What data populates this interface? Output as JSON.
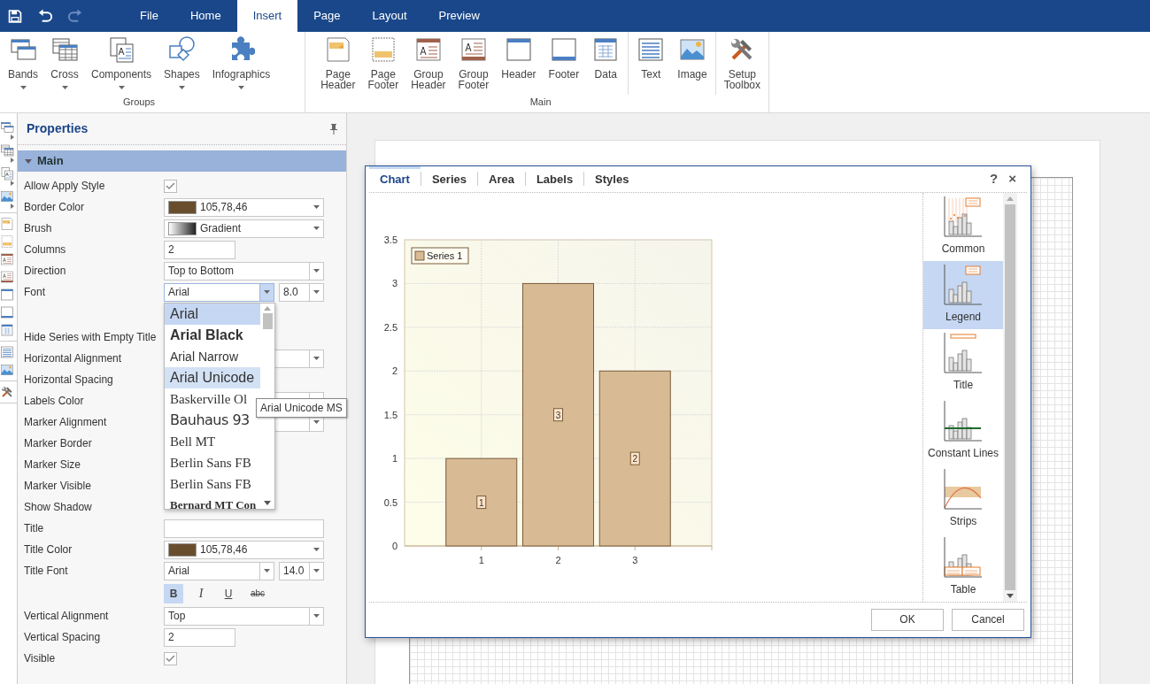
{
  "quick_access": [
    {
      "kind": "save",
      "disabled": false
    },
    {
      "kind": "undo",
      "disabled": false
    },
    {
      "kind": "redo",
      "disabled": true
    }
  ],
  "tabs": [
    {
      "label": "File",
      "selected": false
    },
    {
      "label": "Home",
      "selected": false
    },
    {
      "label": "Insert",
      "selected": true
    },
    {
      "label": "Page",
      "selected": false
    },
    {
      "label": "Layout",
      "selected": false
    },
    {
      "label": "Preview",
      "selected": false
    }
  ],
  "ribbon": {
    "groups": [
      {
        "label": "Groups",
        "sections": [
          [
            {
              "label": "Bands",
              "kind": "bands",
              "dropdown": true
            },
            {
              "label": "Cross",
              "kind": "cross",
              "dropdown": true
            },
            {
              "label": "Components",
              "kind": "components",
              "dropdown": true
            },
            {
              "label": "Shapes",
              "kind": "shapes",
              "dropdown": true
            },
            {
              "label": "Infographics",
              "kind": "infographics",
              "dropdown": true
            }
          ]
        ]
      },
      {
        "label": "Main",
        "sections": [
          [
            {
              "label": "Page Header",
              "kind": "page-header",
              "dropdown": false
            },
            {
              "label": "Page Footer",
              "kind": "page-footer",
              "dropdown": false
            },
            {
              "label": "Group Header",
              "kind": "group-header",
              "dropdown": false
            },
            {
              "label": "Group Footer",
              "kind": "group-footer",
              "dropdown": false
            },
            {
              "label": "Header",
              "kind": "header",
              "dropdown": false
            },
            {
              "label": "Footer",
              "kind": "footer",
              "dropdown": false
            },
            {
              "label": "Data",
              "kind": "data",
              "dropdown": false
            }
          ],
          [
            {
              "label": "Text",
              "kind": "text",
              "dropdown": false
            },
            {
              "label": "Image",
              "kind": "image",
              "dropdown": false
            }
          ],
          [
            {
              "label": "Setup Toolbox",
              "kind": "toolbox",
              "dropdown": false
            }
          ]
        ]
      }
    ]
  },
  "toolbox": [
    [
      {
        "kind": "bands",
        "expandable": true
      },
      {
        "kind": "cross",
        "expandable": true
      },
      {
        "kind": "components",
        "expandable": true
      },
      {
        "kind": "image",
        "expandable": true
      }
    ],
    [
      {
        "kind": "page-header",
        "expandable": false
      },
      {
        "kind": "page-footer",
        "expandable": false
      },
      {
        "kind": "group-header",
        "expandable": false
      },
      {
        "kind": "group-footer",
        "expandable": false
      },
      {
        "kind": "header",
        "expandable": false
      },
      {
        "kind": "footer",
        "expandable": false
      },
      {
        "kind": "data",
        "expandable": false
      }
    ],
    [
      {
        "kind": "text",
        "expandable": false
      },
      {
        "kind": "image",
        "expandable": false
      }
    ],
    [
      {
        "kind": "toolbox",
        "expandable": false
      }
    ]
  ],
  "properties": {
    "title": "Properties",
    "section": {
      "label": "Main",
      "expanded": true
    },
    "rows": [
      {
        "label": "Allow Apply Style",
        "editor": {
          "kind": "checkbox",
          "checked": true
        }
      },
      {
        "label": "Border Color",
        "editor": {
          "kind": "color",
          "color": "#694e2e",
          "value": "105,78,46"
        }
      },
      {
        "label": "Brush",
        "editor": {
          "kind": "brush",
          "value": "Gradient"
        }
      },
      {
        "label": "Columns",
        "editor": {
          "kind": "number",
          "value": "2"
        }
      },
      {
        "label": "Direction",
        "editor": {
          "kind": "select",
          "value": "Top to Bottom"
        }
      },
      {
        "label": "Font",
        "editor": {
          "kind": "font",
          "value": "Arial",
          "size": "8.0",
          "open": true,
          "tooltip": "Arial Unicode MS",
          "options": [
            {
              "label": "Arial",
              "kind": "regular",
              "selected": true,
              "hovered": false
            },
            {
              "label": "Arial Black",
              "kind": "black",
              "selected": false,
              "hovered": false
            },
            {
              "label": "Arial Narrow",
              "kind": "narrow",
              "selected": false,
              "hovered": false
            },
            {
              "label": "Arial Unicode",
              "kind": "regular",
              "selected": false,
              "hovered": true
            },
            {
              "label": "Baskerville Ol",
              "kind": "serif",
              "selected": false,
              "hovered": false
            },
            {
              "label": "Bauhaus 93",
              "kind": "display",
              "selected": false,
              "hovered": false
            },
            {
              "label": "Bell MT",
              "kind": "serif",
              "selected": false,
              "hovered": false
            },
            {
              "label": "Berlin Sans FB",
              "kind": "serif",
              "selected": false,
              "hovered": false
            },
            {
              "label": "Berlin Sans FB",
              "kind": "serif",
              "selected": false,
              "hovered": false
            },
            {
              "label": "Bernard MT Con",
              "kind": "serif-bold",
              "selected": false,
              "hovered": false
            }
          ]
        }
      },
      {
        "label": "Hide Series with Empty Title"
      },
      {
        "label": "Horizontal Alignment",
        "editor": {
          "kind": "select"
        }
      },
      {
        "label": "Horizontal Spacing"
      },
      {
        "label": "Labels Color",
        "editor": {
          "kind": "select"
        }
      },
      {
        "label": "Marker Alignment",
        "editor": {
          "kind": "select"
        }
      },
      {
        "label": "Marker Border"
      },
      {
        "label": "Marker Size"
      },
      {
        "label": "Marker Visible"
      },
      {
        "label": "Show Shadow"
      },
      {
        "label": "Title",
        "editor": {
          "kind": "text"
        }
      },
      {
        "label": "Title Color",
        "editor": {
          "kind": "color",
          "color": "#694e2e",
          "value": "105,78,46"
        }
      },
      {
        "label": "Title Font",
        "editor": {
          "kind": "font",
          "value": "Arial",
          "size": "14.0",
          "open": false,
          "styles": [
            {
              "label": "B",
              "kind": "bold",
              "selected": true
            },
            {
              "label": "I",
              "kind": "italic",
              "selected": false
            },
            {
              "label": "U",
              "kind": "underline",
              "selected": false
            },
            {
              "label": "abc",
              "kind": "strike",
              "selected": false
            }
          ]
        }
      },
      {
        "label": "Vertical Alignment",
        "editor": {
          "kind": "select",
          "value": "Top"
        }
      },
      {
        "label": "Vertical Spacing",
        "editor": {
          "kind": "number",
          "value": "2"
        }
      },
      {
        "label": "Visible",
        "editor": {
          "kind": "checkbox",
          "checked": true
        }
      }
    ]
  },
  "dialog": {
    "tabs": [
      {
        "label": "Chart",
        "selected": true
      },
      {
        "label": "Series",
        "selected": false
      },
      {
        "label": "Area",
        "selected": false
      },
      {
        "label": "Labels",
        "selected": false
      },
      {
        "label": "Styles",
        "selected": false
      }
    ],
    "help": "?",
    "close": "×",
    "chart_data": {
      "type": "bar",
      "categories": [
        "1",
        "2",
        "3"
      ],
      "series": [
        {
          "name": "Series 1",
          "color": "#d8ba94",
          "values": [
            1,
            3,
            2
          ]
        }
      ],
      "ylim": [
        0,
        3.5
      ],
      "yticks": [
        0,
        0.5,
        1,
        1.5,
        2,
        2.5,
        3,
        3.5
      ],
      "grid": true,
      "data_labels": true
    },
    "chart_types": [
      {
        "label": "Common",
        "kind": "common",
        "selected": false
      },
      {
        "label": "Legend",
        "kind": "legend",
        "selected": true
      },
      {
        "label": "Title",
        "kind": "title",
        "selected": false
      },
      {
        "label": "Constant Lines",
        "kind": "constant-lines",
        "selected": false
      },
      {
        "label": "Strips",
        "kind": "strips",
        "selected": false
      },
      {
        "label": "Table",
        "kind": "table",
        "selected": false
      }
    ],
    "buttons": [
      "OK",
      "Cancel"
    ]
  }
}
